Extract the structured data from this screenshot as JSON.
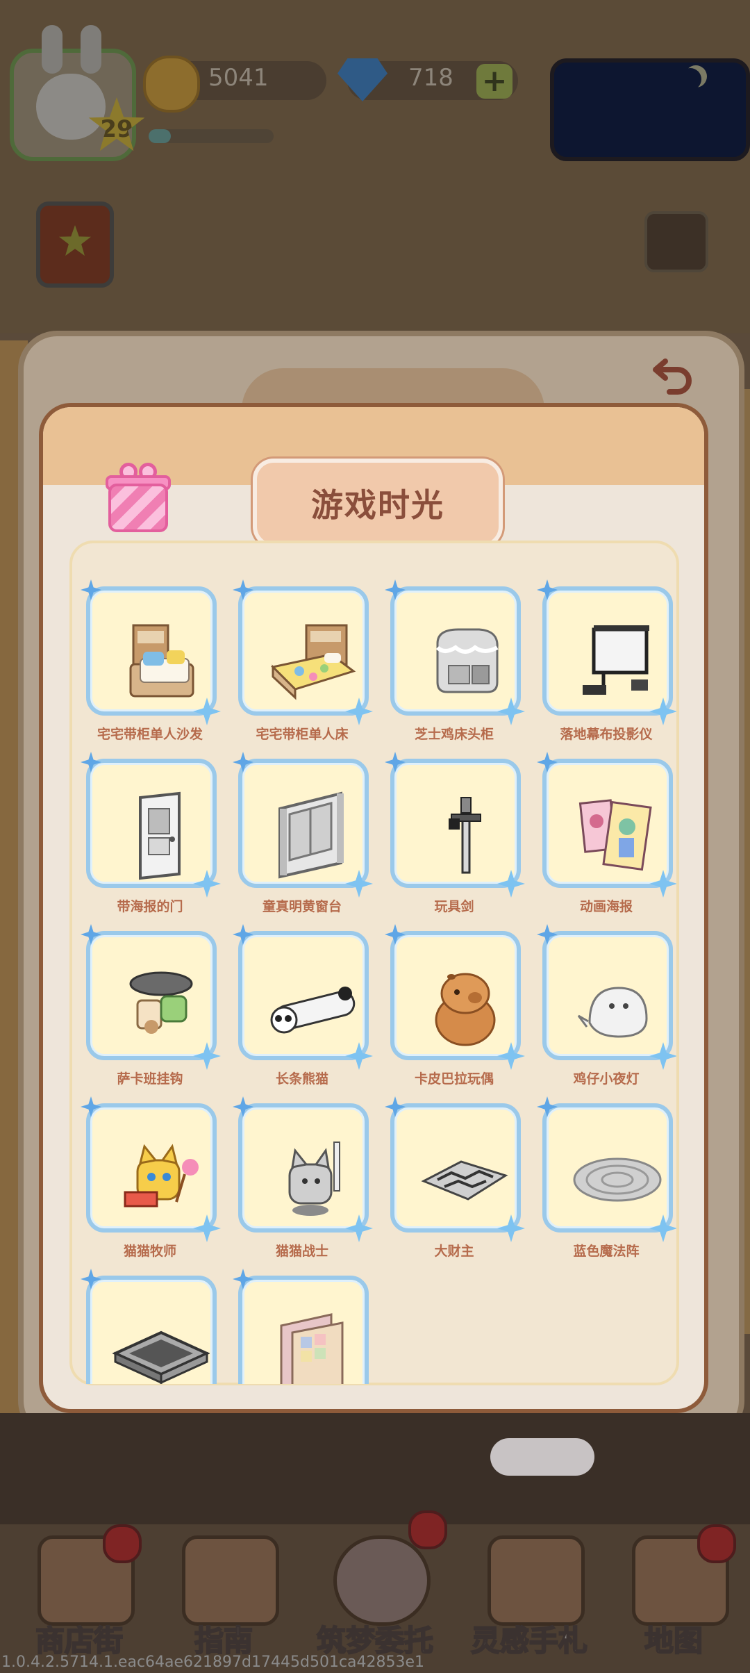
{
  "hud": {
    "level": "29",
    "coins": "5041",
    "gems": "718",
    "add_label": "+",
    "xp_progress": 0.18
  },
  "dialog": {
    "title": "游戏时光",
    "back_icon": "undo-arrow-icon",
    "gift_icon": "gift-box-icon"
  },
  "items": [
    {
      "name": "宅宅带柜单人沙发",
      "icon": "sofa-icon"
    },
    {
      "name": "宅宅带柜单人床",
      "icon": "bed-icon"
    },
    {
      "name": "芝士鸡床头柜",
      "icon": "nightstand-icon"
    },
    {
      "name": "落地幕布投影仪",
      "icon": "projector-screen-icon"
    },
    {
      "name": "带海报的门",
      "icon": "door-icon"
    },
    {
      "name": "童真明黄窗台",
      "icon": "window-icon"
    },
    {
      "name": "玩具剑",
      "icon": "sword-icon"
    },
    {
      "name": "动画海报",
      "icon": "poster-icon"
    },
    {
      "name": "萨卡班挂钩",
      "icon": "wall-hook-icon"
    },
    {
      "name": "长条熊猫",
      "icon": "panda-pillow-icon"
    },
    {
      "name": "卡皮巴拉玩偶",
      "icon": "capybara-plush-icon"
    },
    {
      "name": "鸡仔小夜灯",
      "icon": "chick-lamp-icon"
    },
    {
      "name": "猫猫牧师",
      "icon": "cat-priest-icon"
    },
    {
      "name": "猫猫战士",
      "icon": "cat-warrior-icon"
    },
    {
      "name": "大财主",
      "icon": "rich-rug-icon"
    },
    {
      "name": "蓝色魔法阵",
      "icon": "magic-circle-icon"
    },
    {
      "name": "",
      "icon": "floor-tile-icon"
    },
    {
      "name": "",
      "icon": "wallpaper-icon"
    }
  ],
  "nav": [
    {
      "label": "商店街",
      "icon": "shop-icon",
      "badge": true
    },
    {
      "label": "指南",
      "icon": "guide-icon",
      "badge": false
    },
    {
      "label": "筑梦委托",
      "icon": "commission-icon",
      "badge": true
    },
    {
      "label": "灵感手札",
      "icon": "notebook-icon",
      "badge": false
    },
    {
      "label": "地图",
      "icon": "map-icon",
      "badge": true
    }
  ],
  "version": "1.0.4.2.5714.1.eac64ae621897d17445d501ca42853e1",
  "colors": {
    "modal_bg": "#eee5da",
    "card_border": "#9ac9ea",
    "card_fill": "#fff5cf",
    "label_text": "#b66b4c",
    "title_text": "#8a4e3b"
  }
}
